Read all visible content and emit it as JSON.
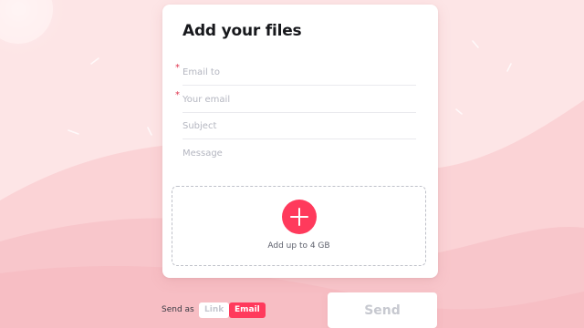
{
  "form": {
    "title": "Add your files",
    "required_marker": "*",
    "email_to_placeholder": "Email to",
    "your_email_placeholder": "Your email",
    "subject_placeholder": "Subject",
    "message_placeholder": "Message"
  },
  "dropzone": {
    "text": "Add up to 4 GB",
    "icon": "plus-icon"
  },
  "send_options": {
    "label": "Send as",
    "link_label": "Link",
    "email_label": "Email",
    "selected": "Email"
  },
  "send_button_label": "Send",
  "colors": {
    "accent": "#ff3a5c",
    "background": "#fde3e4",
    "card": "#ffffff"
  }
}
